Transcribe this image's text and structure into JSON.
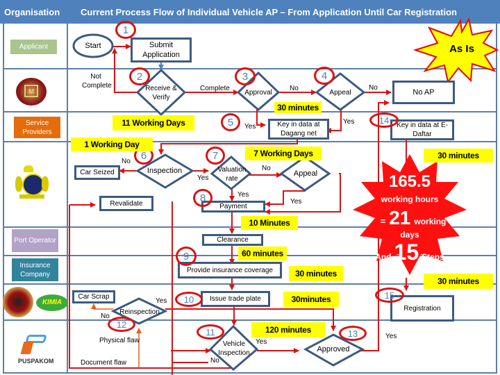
{
  "header": {
    "organisation_label": "Organisation",
    "title": "Current Process Flow of Individual Vehicle AP – From Application Until Car Registration"
  },
  "organisations": [
    {
      "name": "Applicant",
      "color": "#a9c48c",
      "type": "label"
    },
    {
      "name": "MITI logo",
      "type": "logo"
    },
    {
      "name": "Service Providers",
      "color": "#e46c0a",
      "type": "label"
    },
    {
      "name": "Customs crest logo",
      "type": "logo"
    },
    {
      "name": "Port Operator",
      "color": "#b3a2c7",
      "type": "label"
    },
    {
      "name": "Insurance Company",
      "color": "#31849b",
      "type": "label"
    },
    {
      "name": "JPJ / KIMIA logos",
      "type": "logo"
    },
    {
      "name": "PUSPAKOM",
      "type": "logo",
      "logo_text": "PUSPAKOM"
    }
  ],
  "badge": {
    "text": "As Is"
  },
  "summary": {
    "hours": "165.5",
    "hours_label": "working hours",
    "equals": "=",
    "days": "21",
    "days_label_1": "working",
    "days_label_2": "days",
    "and": "And",
    "steps": "15",
    "steps_label": "Steps"
  },
  "nodes": {
    "start": "Start",
    "submit": "Submit Application",
    "receive": "Receive & Verify",
    "approval": "Approval",
    "appeal1": "Appeal",
    "no_ap": "No AP",
    "key_dagang": "Key in data at Dagang net",
    "key_edaftar": "Key in data at E-Daftar",
    "inspection": "Inspection",
    "car_seized": "Car Seized",
    "valuation": "Valuation rate",
    "appeal2": "Appeal",
    "revalidate": "Revalidate",
    "payment": "Payment",
    "clearance": "Clearance",
    "insurance": "Provide insurance coverage",
    "car_scrap": "Car Scrap",
    "reinspection": "Reinspection",
    "trade_plate": "Issue trade plate",
    "vehicle_inspection": "Vehicle Inspection",
    "approved": "Approved",
    "registration": "Registration"
  },
  "steps": [
    "1",
    "2",
    "3",
    "4",
    "5",
    "6",
    "7",
    "8",
    "9",
    "10",
    "11",
    "12",
    "13",
    "14",
    "15"
  ],
  "durations": {
    "d_30min_a": "30 minutes",
    "d_11days": "11 Working Days",
    "d_1day": "1 Working Day",
    "d_7days": "7 Working Days",
    "d_30min_b": "30 minutes",
    "d_10min": "10 Minutes",
    "d_60min": "60 minutes",
    "d_30min_c": "30 minutes",
    "d_30min_d": "30minutes",
    "d_30min_e": "30 minutes",
    "d_120min": "120 minutes"
  },
  "edge_labels": {
    "not_complete": "Not Complete",
    "complete": "Complete",
    "no_1": "No",
    "no_2": "No",
    "yes_5": "Yes",
    "yes_4": "Yes",
    "no_6": "No",
    "yes_6": "Yes",
    "no_7": "No",
    "yes_7": "Yes",
    "yes_appeal": "Yes",
    "yes_reinsp": "Yes",
    "no_reinsp": "No",
    "physical_flaw": "Physical flaw",
    "document_flaw": "Document flaw",
    "yes_11": "Yes",
    "no_11": "No",
    "yes_13": "Yes"
  }
}
